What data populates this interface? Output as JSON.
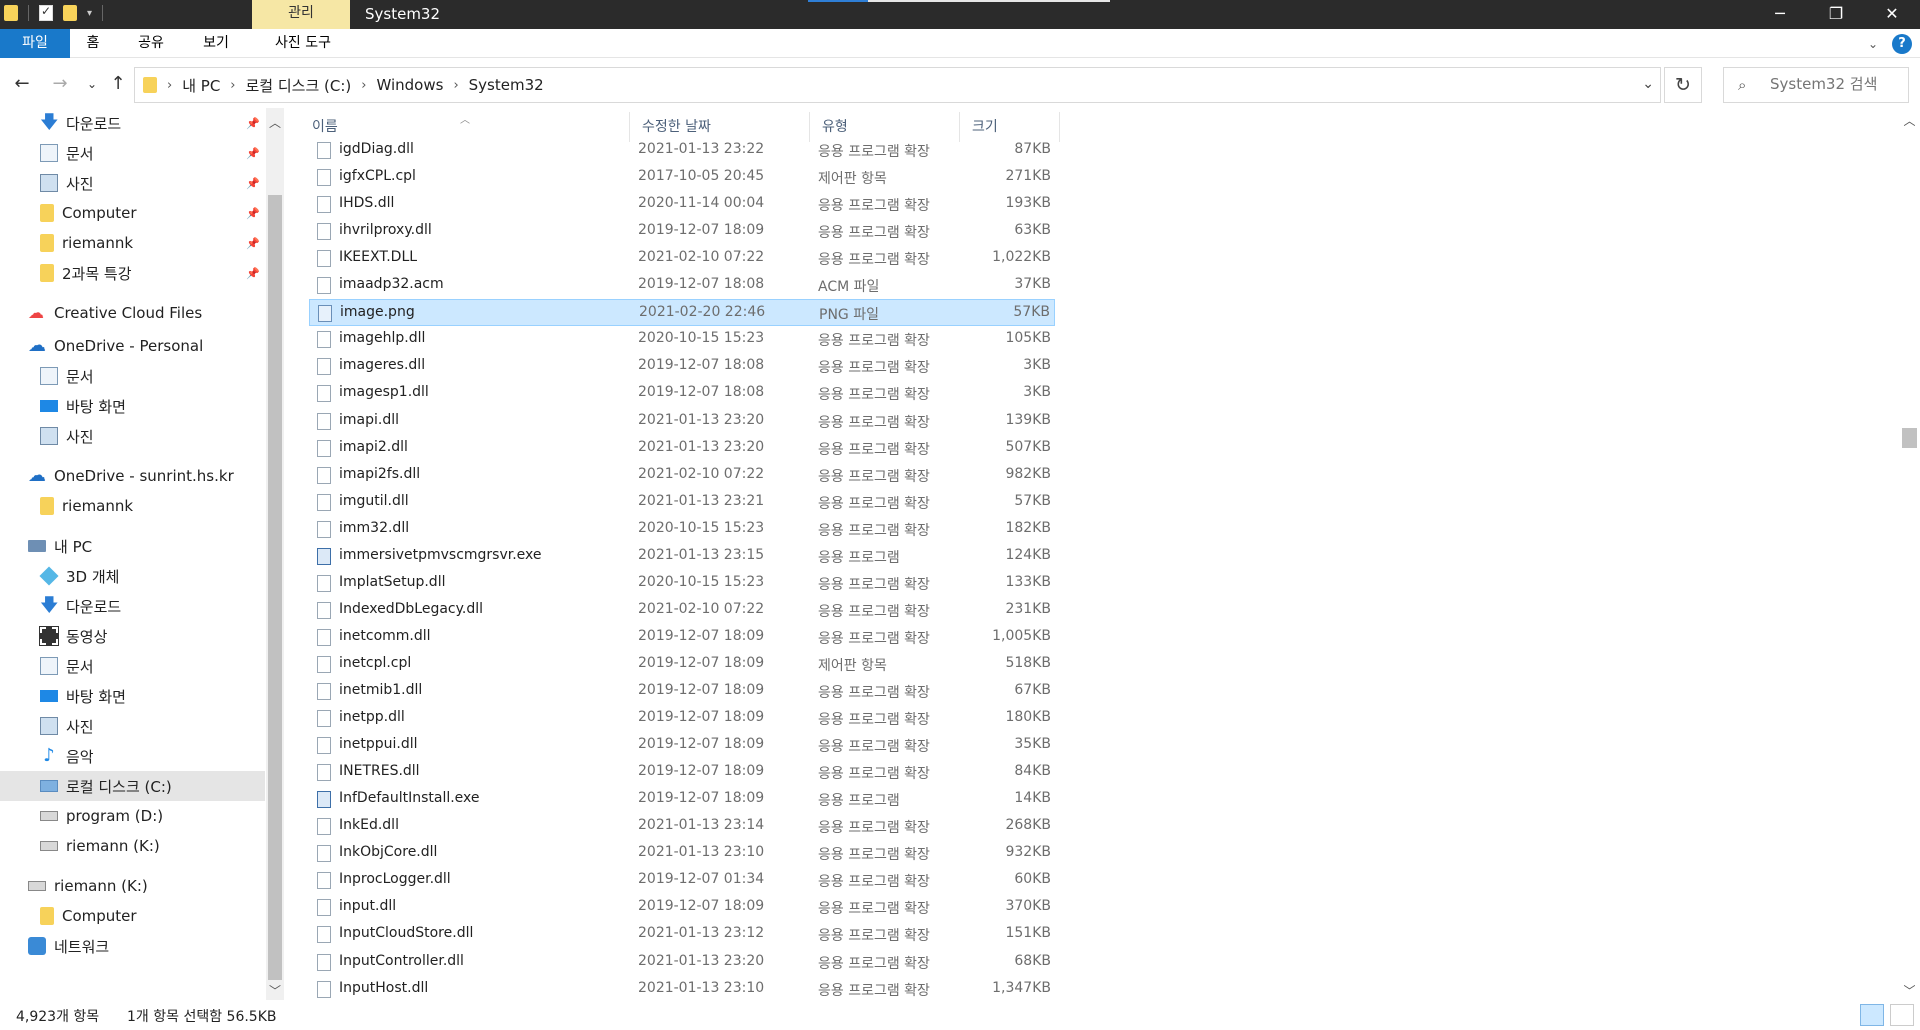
{
  "window": {
    "title": "System32",
    "manage_tab": "관리"
  },
  "ribbon": {
    "tabs": [
      "파일",
      "홈",
      "공유",
      "보기",
      "사진 도구"
    ]
  },
  "address": {
    "crumbs": [
      "내 PC",
      "로컬 디스크 (C:)",
      "Windows",
      "System32"
    ],
    "search_placeholder": "System32 검색"
  },
  "navpane": {
    "items": [
      {
        "label": "다운로드",
        "icon": "download-icon",
        "pinned": true
      },
      {
        "label": "문서",
        "icon": "document-icon",
        "pinned": true
      },
      {
        "label": "사진",
        "icon": "picture-icon",
        "pinned": true
      },
      {
        "label": "Computer",
        "icon": "folder-icon",
        "pinned": true
      },
      {
        "label": "riemannk",
        "icon": "folder-icon",
        "pinned": true
      },
      {
        "label": "2과목 특강",
        "icon": "folder-icon",
        "pinned": true
      },
      {
        "label": "Creative Cloud Files",
        "icon": "creative-cloud-icon"
      },
      {
        "label": "OneDrive - Personal",
        "icon": "cloud-icon"
      },
      {
        "label": "문서",
        "icon": "document-icon"
      },
      {
        "label": "바탕 화면",
        "icon": "desktop-icon"
      },
      {
        "label": "사진",
        "icon": "picture-icon"
      },
      {
        "label": "OneDrive - sunrint.hs.kr",
        "icon": "cloud-icon"
      },
      {
        "label": "riemannk",
        "icon": "folder-icon"
      },
      {
        "label": "내 PC",
        "icon": "pc-icon"
      },
      {
        "label": "3D 개체",
        "icon": "3d-objects-icon"
      },
      {
        "label": "다운로드",
        "icon": "download-icon"
      },
      {
        "label": "동영상",
        "icon": "video-icon"
      },
      {
        "label": "문서",
        "icon": "document-icon"
      },
      {
        "label": "바탕 화면",
        "icon": "desktop-icon"
      },
      {
        "label": "사진",
        "icon": "picture-icon"
      },
      {
        "label": "음악",
        "icon": "music-icon"
      },
      {
        "label": "로컬 디스크 (C:)",
        "icon": "local-disk-icon",
        "selected": true
      },
      {
        "label": "program (D:)",
        "icon": "drive-icon"
      },
      {
        "label": "riemann (K:)",
        "icon": "drive-icon"
      },
      {
        "label": "riemann (K:)",
        "icon": "drive-icon"
      },
      {
        "label": "Computer",
        "icon": "folder-icon"
      },
      {
        "label": "네트워크",
        "icon": "network-icon"
      }
    ]
  },
  "columns": {
    "name": "이름",
    "date": "수정한 날짜",
    "type": "유형",
    "size": "크기"
  },
  "files": [
    {
      "name": "igdDiag.dll",
      "date": "2021-01-13 23:22",
      "type": "응용 프로그램 확장",
      "size": "87KB",
      "kind": "dll"
    },
    {
      "name": "igfxCPL.cpl",
      "date": "2017-10-05 20:45",
      "type": "제어판 항목",
      "size": "271KB",
      "kind": "dll"
    },
    {
      "name": "IHDS.dll",
      "date": "2020-11-14 00:04",
      "type": "응용 프로그램 확장",
      "size": "193KB",
      "kind": "dll"
    },
    {
      "name": "ihvrilproxy.dll",
      "date": "2019-12-07 18:09",
      "type": "응용 프로그램 확장",
      "size": "63KB",
      "kind": "dll"
    },
    {
      "name": "IKEEXT.DLL",
      "date": "2021-02-10 07:22",
      "type": "응용 프로그램 확장",
      "size": "1,022KB",
      "kind": "dll"
    },
    {
      "name": "imaadp32.acm",
      "date": "2019-12-07 18:08",
      "type": "ACM 파일",
      "size": "37KB",
      "kind": "file"
    },
    {
      "name": "image.png",
      "date": "2021-02-20 22:46",
      "type": "PNG 파일",
      "size": "57KB",
      "kind": "png",
      "selected": true
    },
    {
      "name": "imagehlp.dll",
      "date": "2020-10-15 15:23",
      "type": "응용 프로그램 확장",
      "size": "105KB",
      "kind": "dll"
    },
    {
      "name": "imageres.dll",
      "date": "2019-12-07 18:08",
      "type": "응용 프로그램 확장",
      "size": "3KB",
      "kind": "dll"
    },
    {
      "name": "imagesp1.dll",
      "date": "2019-12-07 18:08",
      "type": "응용 프로그램 확장",
      "size": "3KB",
      "kind": "dll"
    },
    {
      "name": "imapi.dll",
      "date": "2021-01-13 23:20",
      "type": "응용 프로그램 확장",
      "size": "139KB",
      "kind": "dll"
    },
    {
      "name": "imapi2.dll",
      "date": "2021-01-13 23:20",
      "type": "응용 프로그램 확장",
      "size": "507KB",
      "kind": "dll"
    },
    {
      "name": "imapi2fs.dll",
      "date": "2021-02-10 07:22",
      "type": "응용 프로그램 확장",
      "size": "982KB",
      "kind": "dll"
    },
    {
      "name": "imgutil.dll",
      "date": "2021-01-13 23:21",
      "type": "응용 프로그램 확장",
      "size": "57KB",
      "kind": "dll"
    },
    {
      "name": "imm32.dll",
      "date": "2020-10-15 15:23",
      "type": "응용 프로그램 확장",
      "size": "182KB",
      "kind": "dll"
    },
    {
      "name": "immersivetpmvscmgrsvr.exe",
      "date": "2021-01-13 23:15",
      "type": "응용 프로그램",
      "size": "124KB",
      "kind": "exe"
    },
    {
      "name": "ImplatSetup.dll",
      "date": "2020-10-15 15:23",
      "type": "응용 프로그램 확장",
      "size": "133KB",
      "kind": "dll"
    },
    {
      "name": "IndexedDbLegacy.dll",
      "date": "2021-02-10 07:22",
      "type": "응용 프로그램 확장",
      "size": "231KB",
      "kind": "dll"
    },
    {
      "name": "inetcomm.dll",
      "date": "2019-12-07 18:09",
      "type": "응용 프로그램 확장",
      "size": "1,005KB",
      "kind": "dll"
    },
    {
      "name": "inetcpl.cpl",
      "date": "2019-12-07 18:09",
      "type": "제어판 항목",
      "size": "518KB",
      "kind": "dll"
    },
    {
      "name": "inetmib1.dll",
      "date": "2019-12-07 18:09",
      "type": "응용 프로그램 확장",
      "size": "67KB",
      "kind": "dll"
    },
    {
      "name": "inetpp.dll",
      "date": "2019-12-07 18:09",
      "type": "응용 프로그램 확장",
      "size": "180KB",
      "kind": "dll"
    },
    {
      "name": "inetppui.dll",
      "date": "2019-12-07 18:09",
      "type": "응용 프로그램 확장",
      "size": "35KB",
      "kind": "dll"
    },
    {
      "name": "INETRES.dll",
      "date": "2019-12-07 18:09",
      "type": "응용 프로그램 확장",
      "size": "84KB",
      "kind": "dll"
    },
    {
      "name": "InfDefaultInstall.exe",
      "date": "2019-12-07 18:09",
      "type": "응용 프로그램",
      "size": "14KB",
      "kind": "exe"
    },
    {
      "name": "InkEd.dll",
      "date": "2021-01-13 23:14",
      "type": "응용 프로그램 확장",
      "size": "268KB",
      "kind": "dll"
    },
    {
      "name": "InkObjCore.dll",
      "date": "2021-01-13 23:10",
      "type": "응용 프로그램 확장",
      "size": "932KB",
      "kind": "dll"
    },
    {
      "name": "InprocLogger.dll",
      "date": "2019-12-07 01:34",
      "type": "응용 프로그램 확장",
      "size": "60KB",
      "kind": "dll"
    },
    {
      "name": "input.dll",
      "date": "2019-12-07 18:09",
      "type": "응용 프로그램 확장",
      "size": "370KB",
      "kind": "dll"
    },
    {
      "name": "InputCloudStore.dll",
      "date": "2021-01-13 23:12",
      "type": "응용 프로그램 확장",
      "size": "151KB",
      "kind": "dll"
    },
    {
      "name": "InputController.dll",
      "date": "2021-01-13 23:20",
      "type": "응용 프로그램 확장",
      "size": "68KB",
      "kind": "dll"
    },
    {
      "name": "InputHost.dll",
      "date": "2021-01-13 23:10",
      "type": "응용 프로그램 확장",
      "size": "1,347KB",
      "kind": "dll"
    }
  ],
  "status": {
    "count": "4,923개 항목",
    "selection": "1개 항목 선택함 56.5KB"
  },
  "colors": {
    "accent": "#1979ca",
    "selection_bg": "#cce8ff",
    "manage_tab_bg": "#f6e7a5"
  }
}
